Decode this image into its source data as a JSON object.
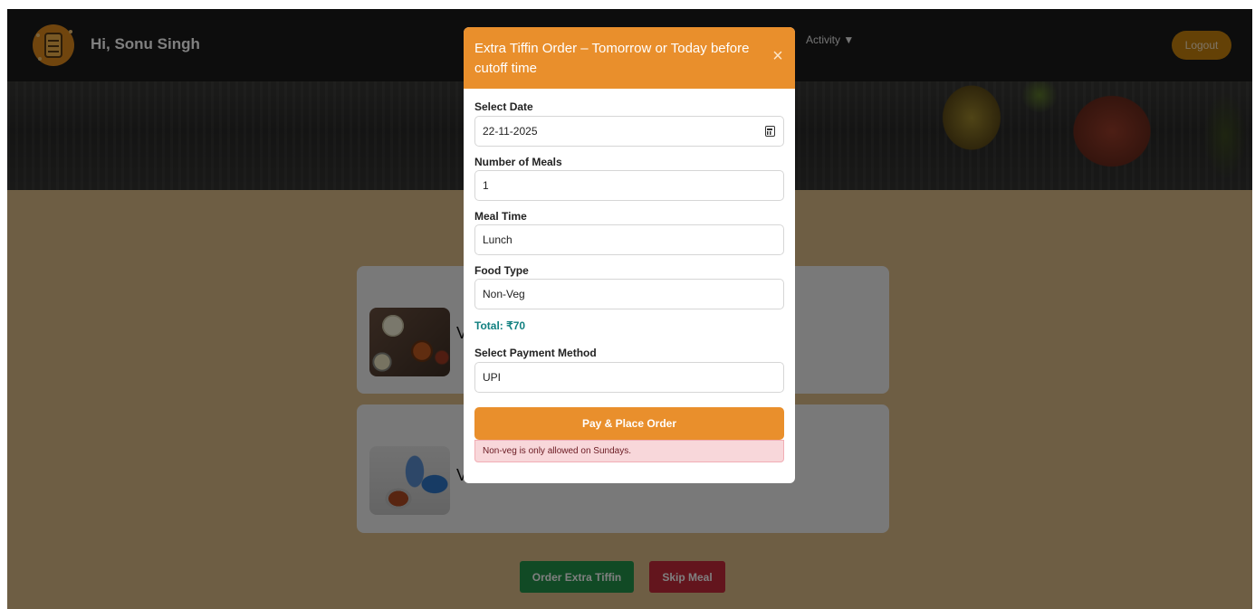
{
  "header": {
    "greeting": "Hi, Sonu Singh",
    "nav_activity": "Activity ▼",
    "logout_label": "Logout",
    "logo_icon": "tiffin-box-icon"
  },
  "cards": [
    {
      "name_stub": "V",
      "image": "thali-meal-image"
    },
    {
      "name_stub": "V",
      "image": "tiffin-container-image"
    }
  ],
  "actions": {
    "order_extra_label": "Order Extra Tiffin",
    "skip_meal_label": "Skip Meal"
  },
  "modal": {
    "title": "Extra Tiffin Order – Tomorrow or Today before cutoff time",
    "close_icon": "×",
    "select_date_label": "Select Date",
    "select_date_value": "22-11-2025",
    "meals_label": "Number of Meals",
    "meals_value": "1",
    "meal_time_label": "Meal Time",
    "meal_time_value": "Lunch",
    "food_type_label": "Food Type",
    "food_type_value": "Non-Veg",
    "total": "Total: ₹70",
    "payment_label": "Select Payment Method",
    "payment_value": "UPI",
    "pay_button_label": "Pay & Place Order",
    "alert_text": "Non-veg is only allowed on Sundays."
  },
  "colors": {
    "header_bg": "#1b1b1b",
    "page_bg": "#dcbc88",
    "modal_accent": "#e98f2c",
    "total_text": "#128080",
    "order_extra_bg": "#23954a",
    "skip_meal_bg": "#c62a3b",
    "alert_bg": "#f8d7da"
  }
}
